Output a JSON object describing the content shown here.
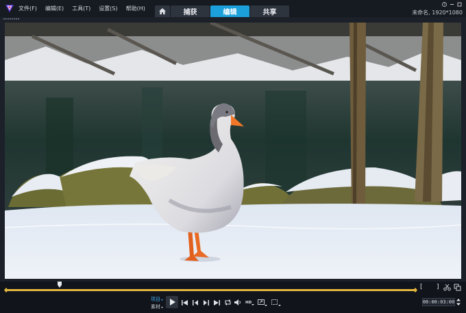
{
  "menu": {
    "items": [
      "文件(F)",
      "编辑(E)",
      "工具(T)",
      "设置(S)",
      "帮助(H)"
    ]
  },
  "tabs": {
    "home_icon": "home-icon",
    "capture": "捕获",
    "edit": "编辑",
    "share": "共享",
    "active": "编辑"
  },
  "window": {
    "project_info": "未命名, 1920*1080"
  },
  "preview": {
    "image_subject": "white goose standing on snow by a pond"
  },
  "scrubber": {
    "mark_in": "[",
    "mark_out": "]",
    "playhead_fraction": 0.13
  },
  "controls": {
    "mode_project": "项目",
    "mode_clip": "素材",
    "timecode": "00:00:03:00",
    "icons": [
      "play-icon",
      "to-start-icon",
      "prev-frame-icon",
      "next-frame-icon",
      "to-end-icon",
      "repeat-icon",
      "volume-icon",
      "hd-icon",
      "resize-icon",
      "crop-icon"
    ]
  },
  "colors": {
    "accent": "#1ba0dc",
    "timeline": "#e3b73d",
    "mode_active": "#3fa7e8"
  }
}
